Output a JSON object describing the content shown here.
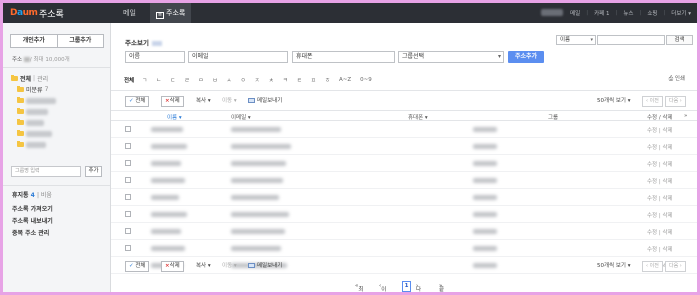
{
  "app": {
    "logo": "Daum",
    "title": "주소록"
  },
  "topnav": {
    "tabs": [
      {
        "label": "메일"
      },
      {
        "label": "주소록"
      }
    ],
    "links": [
      "메일",
      "카페",
      "뉴스",
      "쇼핑",
      "더보기"
    ],
    "cafe_count": "1"
  },
  "sidebar": {
    "add_person": "개인추가",
    "add_group": "그룹추가",
    "quota_label": "주소",
    "quota_max": "/ 최대 10,000개",
    "all_label": "전체",
    "manage_label": "관리",
    "unclassified_label": "미분류",
    "unclassified_count": "7",
    "group_name_placeholder": "그룹명 입력",
    "add_button": "추가",
    "trash_label": "휴지통",
    "trash_count": "4",
    "trash_empty": "비움",
    "menu": [
      "주소록 가져오기",
      "주소록 내보내기",
      "중복 주소 관리"
    ]
  },
  "main": {
    "quick_view_label": "주소보기",
    "search": {
      "select_value": "이름",
      "button": "검색"
    },
    "form": {
      "name": "이름",
      "email": "이메일",
      "phone": "휴대폰",
      "group_select": "그룹선택",
      "add_button": "주소추가"
    },
    "index": {
      "all": "전체",
      "items": [
        "ㄱ",
        "ㄴ",
        "ㄷ",
        "ㄹ",
        "ㅁ",
        "ㅂ",
        "ㅅ",
        "ㅇ",
        "ㅈ",
        "ㅊ",
        "ㅋ",
        "ㅌ",
        "ㅍ",
        "ㅎ",
        "A~Z",
        "0~9"
      ],
      "print": "인쇄"
    },
    "toolbar": {
      "select_all": "전체",
      "delete": "삭제",
      "copy": "복사",
      "move": "이동",
      "send_mail": "메일보내기",
      "per_page": "50개씩 보기",
      "prev": "이전",
      "next": "다음"
    },
    "table": {
      "headers": {
        "name": "이름",
        "email": "이메일",
        "phone": "휴대폰",
        "group": "그룹",
        "edit": "수정 / 삭제"
      },
      "row_count": 9,
      "row_edit": "수정 | 삭제"
    },
    "pager": {
      "first": "최신",
      "prev": "이전",
      "current": "1",
      "next": "다음",
      "last": "끝"
    }
  }
}
